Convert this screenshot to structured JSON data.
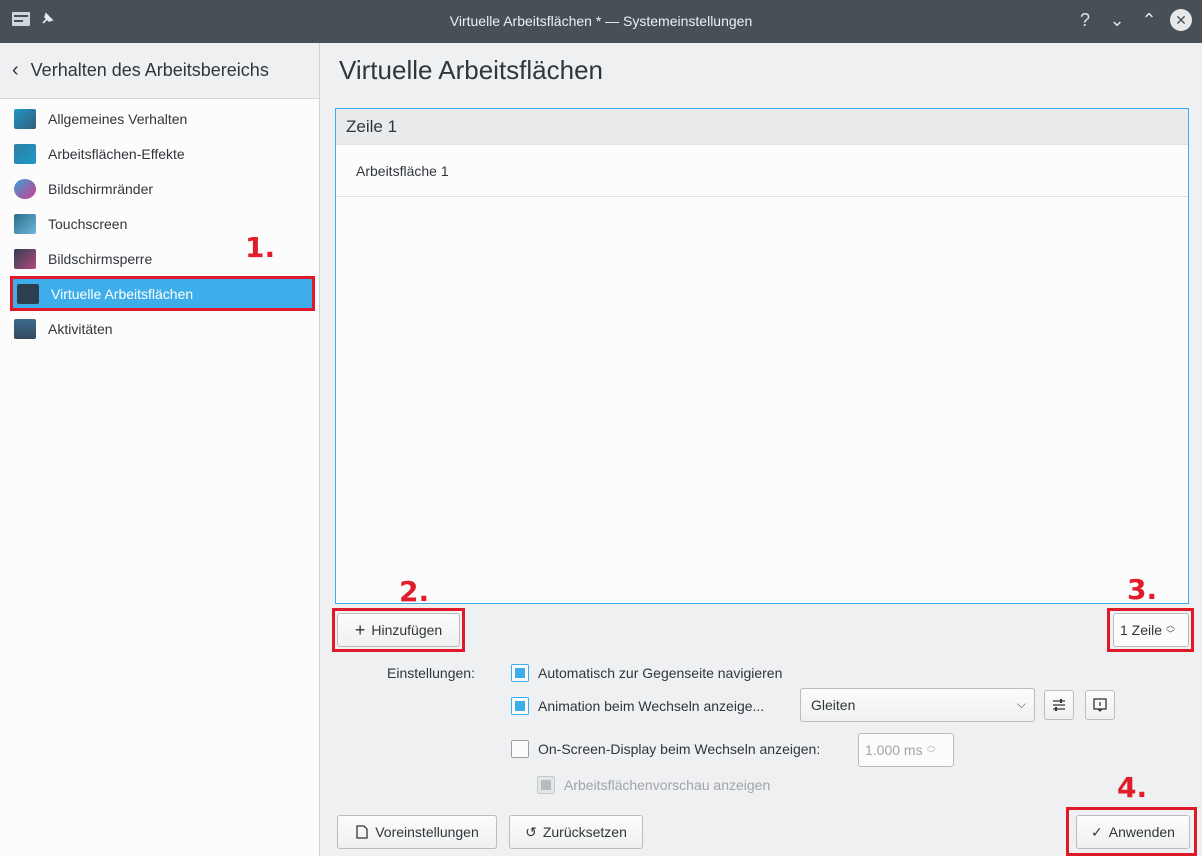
{
  "window": {
    "title": "Virtuelle Arbeitsflächen * — Systemeinstellungen",
    "help_glyph": "?",
    "minimize_glyph": "⌄",
    "maximize_glyph": "⌃",
    "close_glyph": "✕"
  },
  "sidebar": {
    "back_glyph": "‹",
    "header_title": "Verhalten des Arbeitsbereichs",
    "items": [
      {
        "label": "Allgemeines Verhalten",
        "icon": "general-behavior-icon",
        "color": "#3a7ca5"
      },
      {
        "label": "Arbeitsflächen-Effekte",
        "icon": "desktop-effects-icon",
        "color": "#2f8bb5"
      },
      {
        "label": "Bildschirmränder",
        "icon": "screen-edges-icon",
        "color": "#c83a8b"
      },
      {
        "label": "Touchscreen",
        "icon": "touchscreen-icon",
        "color": "#2d6d8a"
      },
      {
        "label": "Bildschirmsperre",
        "icon": "screen-lock-icon",
        "color": "#b44a7d"
      },
      {
        "label": "Virtuelle Arbeitsflächen",
        "icon": "virtual-desktops-icon",
        "color": "#2c3e50"
      },
      {
        "label": "Aktivitäten",
        "icon": "activities-icon",
        "color": "#34495e"
      }
    ]
  },
  "annotations": {
    "a1": "1.",
    "a2": "2.",
    "a3": "3.",
    "a4": "4."
  },
  "main": {
    "title": "Virtuelle Arbeitsflächen",
    "row_header": "Zeile 1",
    "desktops": [
      "Arbeitsfläche 1"
    ],
    "add_button": "Hinzufügen",
    "add_glyph": "+",
    "rows_spin": "1 Zeile",
    "settings_label": "Einstellungen:",
    "opt_wrap": "Automatisch zur Gegenseite navigieren",
    "opt_animation": "Animation beim Wechseln anzeige...",
    "animation_value": "Gleiten",
    "opt_osd": "On-Screen-Display beim Wechseln anzeigen:",
    "osd_value": "1.000 ms",
    "opt_preview": "Arbeitsflächenvorschau anzeigen",
    "defaults_button": "Voreinstellungen",
    "reset_button": "Zurücksetzen",
    "apply_button": "Anwenden",
    "reset_glyph": "↺",
    "apply_glyph": "✓"
  },
  "colors": {
    "accent": "#3daee9",
    "annotation": "#e11d2a"
  }
}
